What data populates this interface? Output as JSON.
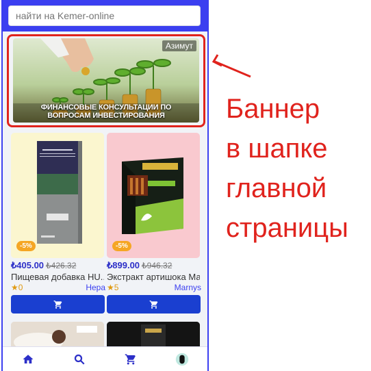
{
  "search": {
    "placeholder": "найти на Kemer-online"
  },
  "banner": {
    "brand": "Азимут",
    "caption_line1": "ФИНАНСОВЫЕ КОНСУЛЬТАЦИИ ПО",
    "caption_line2": "ВОПРОСАМ ИНВЕСТИРОВАНИЯ"
  },
  "products": [
    {
      "discount": "-5%",
      "price": "₺405.00",
      "old_price": "₺426.32",
      "title": "Пищевая добавка HU...",
      "rating": "0",
      "brand": "Hepa"
    },
    {
      "discount": "-5%",
      "price": "₺899.00",
      "old_price": "₺946.32",
      "title": "Экстракт артишока Ма...",
      "rating": "5",
      "brand": "Marnys"
    }
  ],
  "annotation": {
    "line1": "Баннер",
    "line2": "в шапке",
    "line3": "главной",
    "line4": "страницы"
  },
  "colors": {
    "accent": "#3b3ff0",
    "cart_button": "#1a3fd0",
    "annotation": "#e0231d",
    "discount": "#f5a623"
  },
  "icons": {
    "nav": [
      "home-icon",
      "search-icon",
      "cart-icon",
      "profile-icon"
    ],
    "card_button": "cart-icon"
  }
}
